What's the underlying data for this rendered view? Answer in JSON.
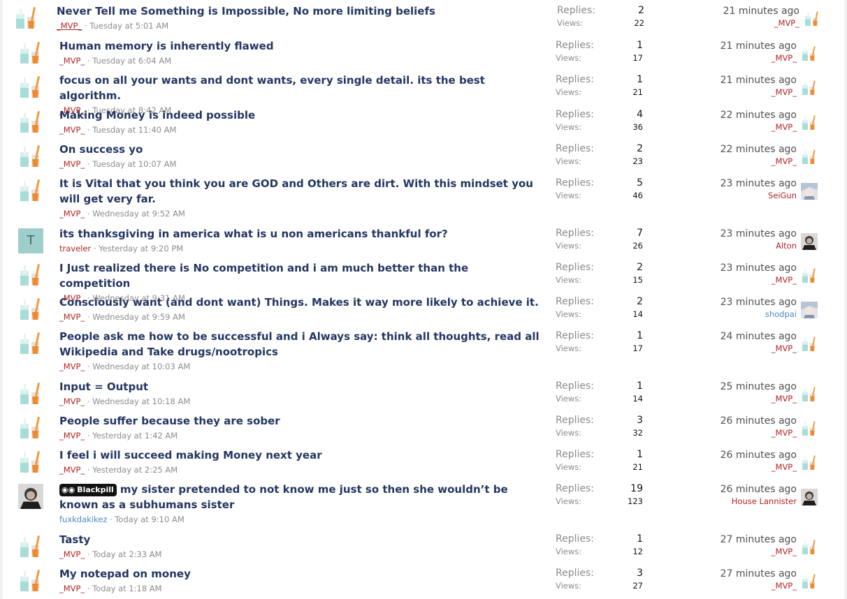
{
  "labels": {
    "replies": "Replies:",
    "views": "Views:"
  },
  "colors": {
    "title": "#243661",
    "user_red": "#b32424",
    "user_blue": "#4a8ac9",
    "meta": "#8c8c8c"
  },
  "threads": [
    {
      "title": "Never Tell me Something is Impossible, No more limiting beliefs",
      "author": "_MVP_",
      "date": "Tuesday at 5:01 AM",
      "replies": "2",
      "views": "22",
      "last_time": "21 minutes ago",
      "last_user": "_MVP_",
      "avatar": "drink-cups-icon",
      "last_avatar": "drink-cups-icon"
    },
    {
      "title": "Human memory is inherently flawed",
      "author": "_MVP_",
      "date": "Tuesday at 6:04 AM",
      "replies": "1",
      "views": "17",
      "last_time": "21 minutes ago",
      "last_user": "_MVP_",
      "avatar": "drink-cups-icon",
      "last_avatar": "drink-cups-icon"
    },
    {
      "title": "focus on all your wants and dont wants, every single detail. its the best algorithm.",
      "author": "_MVP_",
      "date": "Tuesday at 8:42 AM",
      "replies": "1",
      "views": "21",
      "last_time": "21 minutes ago",
      "last_user": "_MVP_",
      "avatar": "drink-cups-icon",
      "last_avatar": "drink-cups-icon"
    },
    {
      "title": "Making Money is indeed possible",
      "author": "_MVP_",
      "date": "Tuesday at 11:40 AM",
      "replies": "4",
      "views": "36",
      "last_time": "22 minutes ago",
      "last_user": "_MVP_",
      "avatar": "drink-cups-icon",
      "last_avatar": "drink-cups-icon"
    },
    {
      "title": "On success yo",
      "author": "_MVP_",
      "date": "Tuesday at 10:07 AM",
      "replies": "2",
      "views": "23",
      "last_time": "22 minutes ago",
      "last_user": "_MVP_",
      "avatar": "drink-cups-icon",
      "last_avatar": "drink-cups-icon"
    },
    {
      "title": "It is Vital that you think you are GOD and Others are dirt. With this mindset you will get very far.",
      "author": "_MVP_",
      "date": "Wednesday at 9:52 AM",
      "replies": "5",
      "views": "46",
      "last_time": "23 minutes ago",
      "last_user": "SeiGun",
      "avatar": "drink-cups-icon",
      "last_avatar": "anime-avatar-icon"
    },
    {
      "title": "its thanksgiving in america what is u non americans thankful for?",
      "author": "traveler",
      "date": "Yesterday at 9:20 PM",
      "replies": "7",
      "views": "26",
      "last_time": "23 minutes ago",
      "last_user": "Alton",
      "avatar": "letter-avatar",
      "avatar_letter": "T",
      "last_avatar": "photo-avatar-icon"
    },
    {
      "title": "I Just realized there is No competition and i am much better than the competition",
      "author": "_MVP_",
      "date": "Wednesday at 9:31 AM",
      "replies": "2",
      "views": "15",
      "last_time": "23 minutes ago",
      "last_user": "_MVP_",
      "avatar": "drink-cups-icon",
      "last_avatar": "drink-cups-icon"
    },
    {
      "title": "Consciously want (and dont want) Things. Makes it way more likely to achieve it.",
      "author": "_MVP_",
      "date": "Wednesday at 9:59 AM",
      "replies": "2",
      "views": "14",
      "last_time": "23 minutes ago",
      "last_user": "shodpai",
      "last_user_blue": true,
      "avatar": "drink-cups-icon",
      "last_avatar": "anime-avatar-icon"
    },
    {
      "title": "People ask me how to be successful and i Always say: think all thoughts, read all Wikipedia and Take drugs/nootropics",
      "author": "_MVP_",
      "date": "Wednesday at 10:03 AM",
      "replies": "1",
      "views": "17",
      "last_time": "24 minutes ago",
      "last_user": "_MVP_",
      "avatar": "drink-cups-icon",
      "last_avatar": "drink-cups-icon"
    },
    {
      "title": "Input = Output",
      "author": "_MVP_",
      "date": "Wednesday at 10:18 AM",
      "replies": "1",
      "views": "14",
      "last_time": "25 minutes ago",
      "last_user": "_MVP_",
      "avatar": "drink-cups-icon",
      "last_avatar": "drink-cups-icon"
    },
    {
      "title": "People suffer because they are sober",
      "author": "_MVP_",
      "date": "Yesterday at 1:42 AM",
      "replies": "3",
      "views": "32",
      "last_time": "26 minutes ago",
      "last_user": "_MVP_",
      "avatar": "drink-cups-icon",
      "last_avatar": "drink-cups-icon"
    },
    {
      "title": "I feel i will succeed making Money next year",
      "author": "_MVP_",
      "date": "Yesterday at 2:25 AM",
      "replies": "1",
      "views": "21",
      "last_time": "26 minutes ago",
      "last_user": "_MVP_",
      "avatar": "drink-cups-icon",
      "last_avatar": "drink-cups-icon"
    },
    {
      "title": "my sister pretended to not know me just so then she wouldn’t be known as a subhumans sister",
      "prefix": "Blackpill",
      "author": "fuxkdakikez",
      "author_blue": true,
      "date": "Today at 9:10 AM",
      "replies": "19",
      "views": "123",
      "last_time": "26 minutes ago",
      "last_user": "House Lannister",
      "avatar": "photo-avatar-icon",
      "last_avatar": "photo-avatar-icon"
    },
    {
      "title": "Tasty",
      "author": "_MVP_",
      "date": "Today at 2:33 AM",
      "replies": "1",
      "views": "12",
      "last_time": "27 minutes ago",
      "last_user": "_MVP_",
      "avatar": "drink-cups-icon",
      "last_avatar": "drink-cups-icon"
    },
    {
      "title": "My notepad on money",
      "author": "_MVP_",
      "date": "Today at 1:18 AM",
      "replies": "3",
      "views": "27",
      "last_time": "27 minutes ago",
      "last_user": "_MVP_",
      "avatar": "drink-cups-icon",
      "last_avatar": "drink-cups-icon"
    }
  ]
}
